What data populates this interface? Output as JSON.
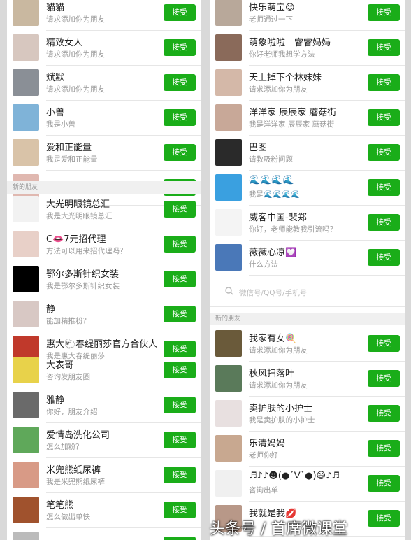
{
  "buttons": {
    "accept_label": "接受"
  },
  "left_column": {
    "section_label": "新的朋友",
    "rows": [
      {
        "name": "貓貓",
        "msg": "请求添加你为朋友",
        "avatar_color": "#c9b8a0"
      },
      {
        "name": "精致女人",
        "msg": "请求添加你为朋友",
        "avatar_color": "#d7c7bf"
      },
      {
        "name": "斌默",
        "msg": "请求添加你为朋友",
        "avatar_color": "#8a8f96"
      },
      {
        "name": "小兽",
        "msg": "我是小兽",
        "avatar_color": "#7fb3d8"
      },
      {
        "name": "爱和正能量",
        "msg": "我是爱和正能量",
        "avatar_color": "#d9c3a8"
      },
      {
        "name": "",
        "msg": "",
        "avatar_color": "#e0b8b0"
      },
      {
        "name": "大光明眼镜总汇",
        "msg": "我是大光明眼镜总汇",
        "avatar_color": "#f2f2f2"
      },
      {
        "name": "C👄7元招代理",
        "msg": "方法可以用来招代理吗？",
        "avatar_color": "#e8d0c8"
      },
      {
        "name": "鄂尔多斯针织女装",
        "msg": "我是鄂尔多斯针织女装",
        "avatar_color": "#000000"
      },
      {
        "name": "静",
        "msg": "能加精推粉？",
        "avatar_color": "#d8c8c4"
      },
      {
        "name": "惠大🐑春缇丽莎官方合伙人",
        "msg": "我是惠大春缇丽莎",
        "avatar_color": "#c0392b"
      },
      {
        "name": "大表哥",
        "msg": "咨询发朋友圈",
        "avatar_color": "#e8d24a"
      },
      {
        "name": "雅静",
        "msg": "你好，朋友介绍",
        "avatar_color": "#6a6a6a"
      },
      {
        "name": "爱情岛洗化公司",
        "msg": "怎么加粉？",
        "avatar_color": "#5fa85a"
      },
      {
        "name": "米兜熊纸尿裤",
        "msg": "我是米兜熊纸尿裤",
        "avatar_color": "#d89a86"
      },
      {
        "name": "笔笔熊",
        "msg": "怎么做出单快",
        "avatar_color": "#a0522d"
      },
      {
        "name": "",
        "msg": "",
        "avatar_color": "#bbbbbb"
      }
    ]
  },
  "right_column": {
    "section_label": "新的朋友",
    "search_placeholder": "微信号/QQ号/手机号",
    "rows_top": [
      {
        "name": "快乐萌宝😊",
        "msg": "老师通过一下",
        "avatar_color": "#b8a89a"
      },
      {
        "name": "萌象啦啦—睿睿妈妈",
        "msg": "你好老师我想学方法",
        "avatar_color": "#8a6a5a"
      },
      {
        "name": "天上掉下个林妹妹",
        "msg": "请求添加你为朋友",
        "avatar_color": "#d4b8a8"
      },
      {
        "name": "洋洋家 辰辰家 蘑菇街",
        "msg": "我是洋洋家 辰辰家 蘑菇街",
        "avatar_color": "#c8a898"
      },
      {
        "name": "巴图",
        "msg": "请教吸粉问题",
        "avatar_color": "#2a2a2a"
      },
      {
        "name": "🌊🌊🌊🌊",
        "msg": "我是🌊🌊🌊🌊",
        "avatar_color": "#3aa0e0"
      },
      {
        "name": "威客中国-裴郑",
        "msg": "你好，老师能教我引流吗？",
        "avatar_color": "#f4f4f4"
      },
      {
        "name": "薇薇心凉💟",
        "msg": "什么方法",
        "avatar_color": "#4a78b8"
      }
    ],
    "rows_bottom": [
      {
        "name": "我家有女🍭",
        "msg": "请求添加你为朋友",
        "avatar_color": "#6a5a3a"
      },
      {
        "name": "秋风扫落叶",
        "msg": "请求添加你为朋友",
        "avatar_color": "#5a7a5a"
      },
      {
        "name": "卖护肤的小护士",
        "msg": "我是卖护肤的小护士",
        "avatar_color": "#e8e0e0"
      },
      {
        "name": "乐清妈妈",
        "msg": "老师你好",
        "avatar_color": "#c8a890"
      },
      {
        "name": "♬♪♪☻(●ˇ∀ˇ●)😄♪♬",
        "msg": "咨询出单",
        "avatar_color": "#f0f0f0"
      },
      {
        "name": "我就是我💋",
        "msg": "",
        "avatar_color": "#b89888"
      }
    ]
  },
  "watermark": "头条号 / 首席微课堂"
}
